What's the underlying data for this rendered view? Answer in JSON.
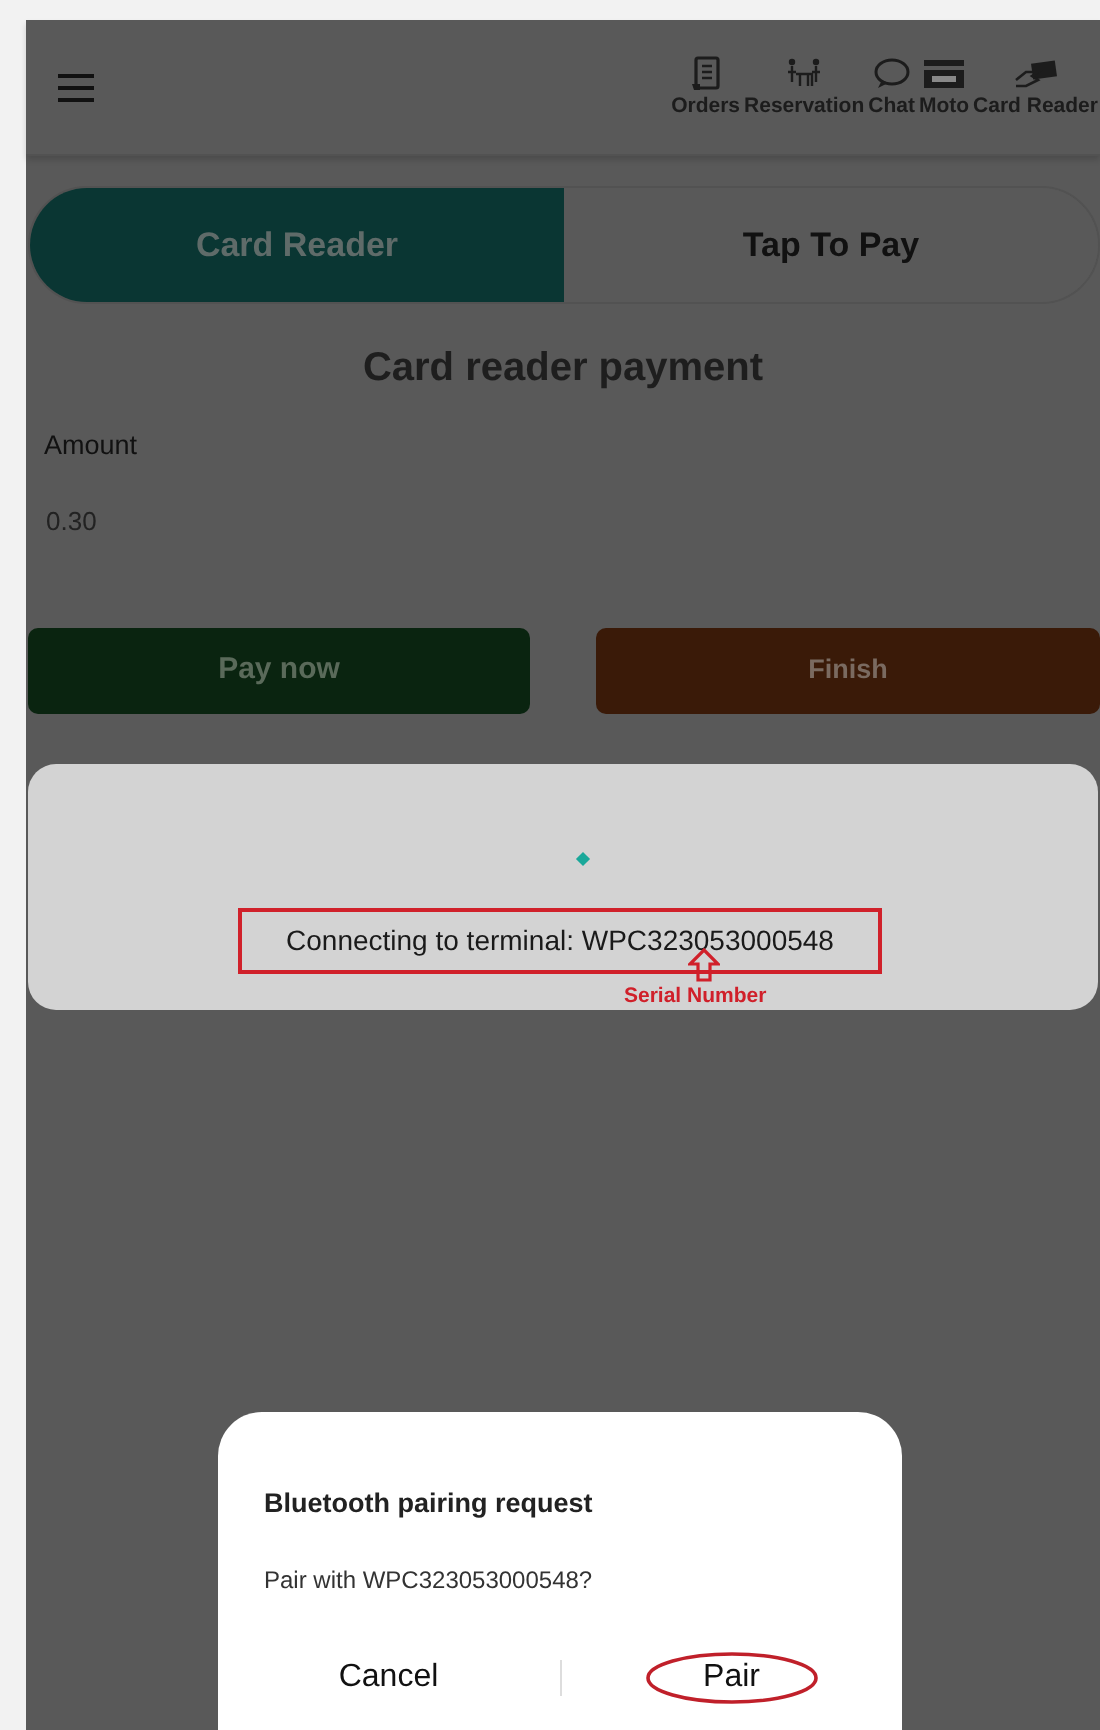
{
  "header": {
    "nav": [
      {
        "label": "Orders",
        "kind": "orders"
      },
      {
        "label": "Reservation",
        "kind": "reservation"
      },
      {
        "label": "Chat",
        "kind": "chat"
      },
      {
        "label": "Moto",
        "kind": "moto"
      },
      {
        "label": "Card Reader",
        "kind": "card_reader"
      }
    ]
  },
  "payment_mode_tabs": [
    {
      "label": "Card Reader",
      "selected": true
    },
    {
      "label": "Tap To Pay",
      "selected": false
    }
  ],
  "title": "Card reader payment",
  "amount": {
    "label": "Amount",
    "value": "0.30"
  },
  "buttons": [
    {
      "label": "Pay now",
      "kind": "pay"
    },
    {
      "label": "Finish",
      "kind": "finish"
    }
  ],
  "connecting_dialog": {
    "message": "Connecting to terminal: WPC323053000548",
    "annotation": "Serial Number"
  },
  "pairing_dialog": {
    "title": "Bluetooth pairing request",
    "message": "Pair with WPC323053000548?",
    "buttons": [
      {
        "label": "Cancel",
        "highlighted": false
      },
      {
        "label": "Pair",
        "highlighted": true
      }
    ]
  }
}
